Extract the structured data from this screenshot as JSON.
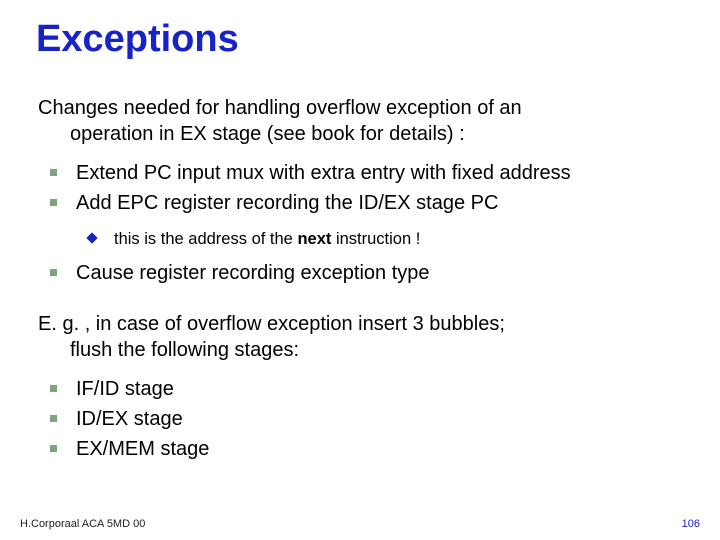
{
  "title": "Exceptions",
  "para1_l1": "Changes needed for handling overflow exception of an",
  "para1_l2": "operation in EX stage (see book for details) :",
  "bullets1": {
    "b1": "Extend PC input mux with extra entry with fixed address",
    "b2": "Add EPC register recording the ID/EX stage PC"
  },
  "sub1_prefix": "this is the address of the ",
  "sub1_bold": "next",
  "sub1_suffix": " instruction !",
  "bullets2": {
    "b1": "Cause register recording exception type"
  },
  "para2_l1": "E. g. , in case of overflow exception insert 3 bubbles;",
  "para2_l2": "flush the following stages:",
  "bullets3": {
    "b1": "IF/ID stage",
    "b2": "ID/EX stage",
    "b3": "EX/MEM stage"
  },
  "footer_left": "H.Corporaal   ACA 5MD 00",
  "footer_right": "106"
}
